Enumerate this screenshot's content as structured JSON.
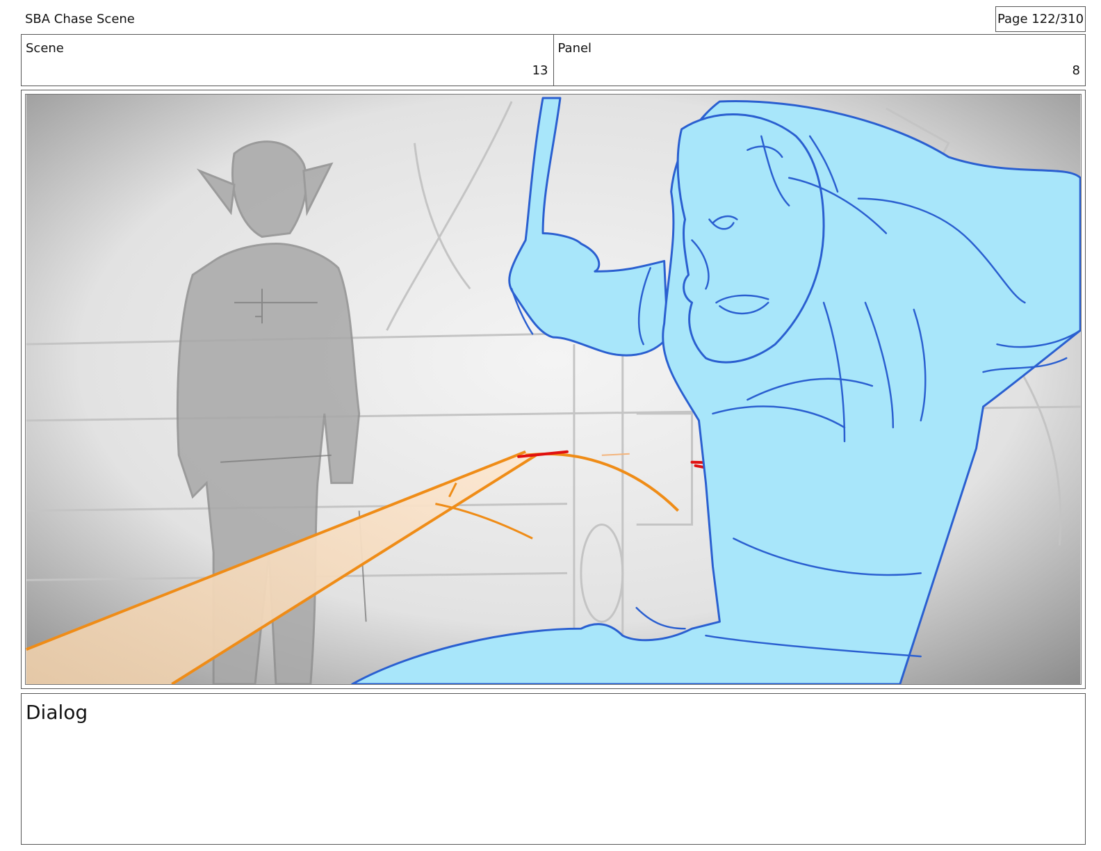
{
  "header": {
    "project_title": "SBA Chase Scene",
    "page_label": "Page 122/310"
  },
  "info": {
    "scene_label": "Scene",
    "scene_number": "13",
    "panel_label": "Panel",
    "panel_number": "8"
  },
  "panel": {
    "image_description": "storyboard-sketch",
    "colors": {
      "background_gray": "#e9e9e9",
      "figure_gray": "#a8a8a8",
      "character_fill": "#a8e6fa",
      "character_line": "#2a5fd0",
      "beam_fill": "#fde0c4",
      "beam_line": "#ef8c17",
      "accent_red": "#e01010"
    }
  },
  "dialog": {
    "label": "Dialog",
    "text": ""
  }
}
